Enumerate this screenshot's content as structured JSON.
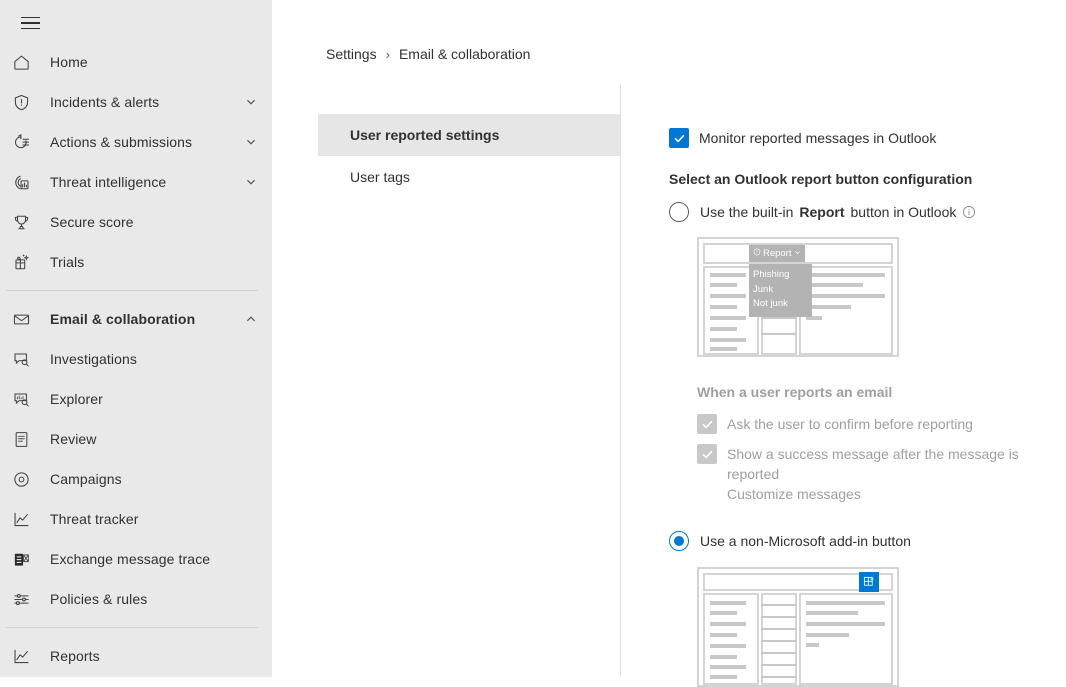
{
  "sidebar": {
    "menu_icon": "hamburger-icon",
    "items": [
      {
        "label": "Home",
        "icon": "home-icon",
        "expandable": false,
        "active": false
      },
      {
        "label": "Incidents & alerts",
        "icon": "shield-alert-icon",
        "expandable": true,
        "chevron": "chevron-down-icon",
        "active": false
      },
      {
        "label": "Actions & submissions",
        "icon": "history-list-icon",
        "expandable": true,
        "chevron": "chevron-down-icon",
        "active": false
      },
      {
        "label": "Threat intelligence",
        "icon": "threat-radar-icon",
        "expandable": true,
        "chevron": "chevron-down-icon",
        "active": false
      },
      {
        "label": "Secure score",
        "icon": "trophy-icon",
        "expandable": false,
        "active": false
      },
      {
        "label": "Trials",
        "icon": "trials-gift-icon",
        "expandable": false,
        "active": false
      },
      {
        "label": "Email & collaboration",
        "icon": "envelope-icon",
        "expandable": true,
        "chevron": "chevron-up-icon",
        "active": true
      },
      {
        "label": "Investigations",
        "icon": "investigations-icon",
        "expandable": false,
        "active": false
      },
      {
        "label": "Explorer",
        "icon": "explorer-icon",
        "expandable": false,
        "active": false
      },
      {
        "label": "Review",
        "icon": "review-list-icon",
        "expandable": false,
        "active": false
      },
      {
        "label": "Campaigns",
        "icon": "campaigns-target-icon",
        "expandable": false,
        "active": false
      },
      {
        "label": "Threat tracker",
        "icon": "trend-chart-icon",
        "expandable": false,
        "active": false
      },
      {
        "label": "Exchange message trace",
        "icon": "exchange-icon",
        "expandable": false,
        "active": false
      },
      {
        "label": "Policies & rules",
        "icon": "sliders-icon",
        "expandable": false,
        "active": false
      },
      {
        "label": "Reports",
        "icon": "reports-chart-icon",
        "expandable": false,
        "active": false
      }
    ]
  },
  "breadcrumb": {
    "root": "Settings",
    "separator": "›",
    "current": "Email & collaboration"
  },
  "tabs": [
    {
      "label": "User reported settings",
      "selected": true
    },
    {
      "label": "User tags",
      "selected": false
    }
  ],
  "detail": {
    "monitor_checkbox": {
      "label": "Monitor reported messages in Outlook",
      "checked": true,
      "enabled": true
    },
    "config_heading": "Select an Outlook report button configuration",
    "option_builtin": {
      "selected": false,
      "label_before": "Use the built-in ",
      "label_strong": "Report",
      "label_after": " button in Outlook",
      "info_icon": "info-circle-icon"
    },
    "preview_builtin": {
      "report_button_label": "Report",
      "report_button_icon": "shield-icon",
      "report_button_chevron": "chevron-down-icon",
      "menu_items": [
        "Phishing",
        "Junk",
        "Not junk"
      ]
    },
    "when_reports_heading": "When a user reports an email",
    "sub_options": [
      {
        "label": "Ask the user to confirm before reporting",
        "checked": true,
        "enabled": false
      },
      {
        "label": "Show a success message after the message is reported",
        "checked": true,
        "enabled": false
      }
    ],
    "customize_link": "Customize messages",
    "option_addin": {
      "selected": true,
      "label": "Use a non-Microsoft add-in button"
    },
    "preview_addin": {
      "addin_icon": "addin-grid-icon"
    }
  },
  "colors": {
    "accent": "#0078d4",
    "sidebar_bg": "#e9e9e9",
    "tab_selected_bg": "#e6e6e6",
    "text": "#323130",
    "disabled_text": "#a19f9d",
    "mock_gray": "#c8c8c8",
    "mock_border": "#d4d4d4",
    "mock_overlay": "#b3b3b3"
  }
}
